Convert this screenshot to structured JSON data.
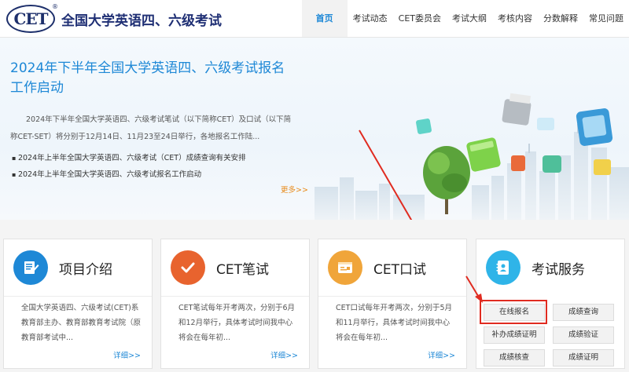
{
  "header": {
    "logo_text": "CET",
    "logo_mark": "®",
    "site_title": "全国大学英语四、六级考试",
    "nav": [
      "首页",
      "考试动态",
      "CET委员会",
      "考试大纲",
      "考核内容",
      "分数解释",
      "常见问题"
    ]
  },
  "banner": {
    "title": "2024年下半年全国大学英语四、六级考试报名工作启动",
    "desc": "2024年下半年全国大学英语四、六级考试笔试（以下简称CET）及口试（以下简称CET-SET）将分别于12月14日、11月23至24日举行，各地报名工作陆...",
    "news": [
      "2024年上半年全国大学英语四、六级考试（CET）成绩查询有关安排",
      "2024年上半年全国大学英语四、六级考试报名工作启动"
    ],
    "more": "更多>>"
  },
  "cards": [
    {
      "title": "项目介绍",
      "text": "全国大学英语四、六级考试(CET)系教育部主办、教育部教育考试院（原教育部考试中...",
      "link": "详细>>"
    },
    {
      "title": "CET笔试",
      "text": "CET笔试每年开考两次，分别于6月和12月举行，具体考试时间我中心将会在每年初...",
      "link": "详细>>"
    },
    {
      "title": "CET口试",
      "text": "CET口试每年开考两次，分别于5月和11月举行，具体考试时间我中心将会在每年初...",
      "link": "详细>>"
    },
    {
      "title": "考试服务",
      "buttons": [
        "在线报名",
        "成绩查询",
        "补办成绩证明",
        "成绩验证",
        "成绩核查",
        "成绩证明"
      ]
    }
  ],
  "colors": {
    "accent": "#1e88d6",
    "more": "#e88a1a",
    "highlight": "#e02b20",
    "arrow": "#e02b20"
  },
  "icons": [
    "document-edit-icon",
    "checkmark-icon",
    "form-window-icon",
    "address-book-icon"
  ]
}
